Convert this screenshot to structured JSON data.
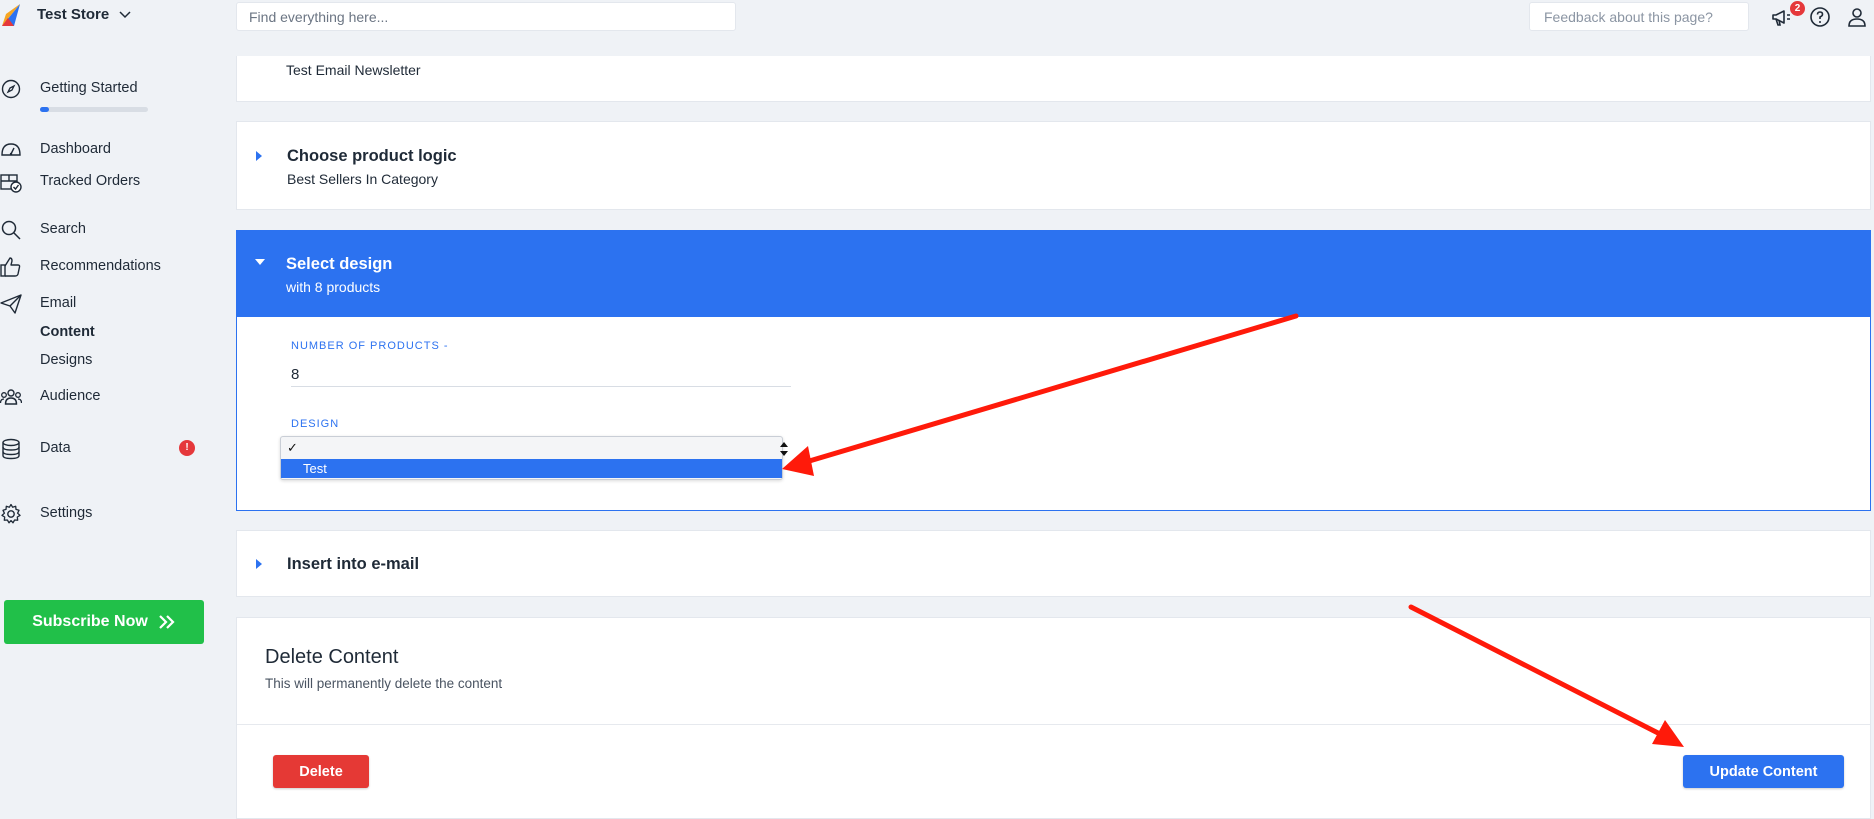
{
  "header": {
    "store_name": "Test Store",
    "search_placeholder": "Find everything here...",
    "feedback_placeholder": "Feedback about this page?",
    "notification_count": "2"
  },
  "sidebar": {
    "getting_started": {
      "label": "Getting Started",
      "progress_percent": 8
    },
    "items": [
      {
        "label": "Dashboard",
        "icon": "dashboard-icon"
      },
      {
        "label": "Tracked Orders",
        "icon": "tracked-orders-icon"
      },
      {
        "label": "Search",
        "icon": "search-icon"
      },
      {
        "label": "Recommendations",
        "icon": "thumbs-up-icon"
      },
      {
        "label": "Email",
        "icon": "paper-plane-icon"
      },
      {
        "label": "Audience",
        "icon": "users-icon"
      },
      {
        "label": "Data",
        "icon": "database-icon"
      },
      {
        "label": "Settings",
        "icon": "gear-icon"
      }
    ],
    "email_sub": {
      "content": "Content",
      "designs": "Designs"
    },
    "data_alert": "!",
    "subscribe_label": "Subscribe Now"
  },
  "main": {
    "newsletter_name": "Test Email Newsletter",
    "product_logic": {
      "title": "Choose product logic",
      "value": "Best Sellers In Category"
    },
    "select_design": {
      "title": "Select design",
      "subtitle": "with 8 products",
      "num_products_label": "NUMBER OF PRODUCTS -",
      "num_products_value": "8",
      "design_label": "DESIGN",
      "dropdown_checked": "✓",
      "dropdown_option": "Test"
    },
    "insert_email": {
      "title": "Insert into e-mail"
    },
    "delete_section": {
      "title": "Delete Content",
      "subtitle": "This will permanently delete the content",
      "delete_label": "Delete",
      "update_label": "Update Content"
    }
  },
  "colors": {
    "accent": "#2c72f0",
    "danger": "#e53935",
    "success": "#21c049",
    "annotation": "#ff1a0a"
  }
}
